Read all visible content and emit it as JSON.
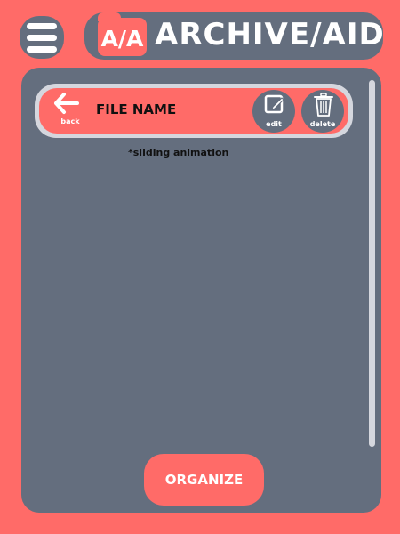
{
  "app": {
    "logo_text": "A/A",
    "title": "ARCHIVE/AID"
  },
  "file_bar": {
    "back_label": "back",
    "file_name": "FILE NAME",
    "edit_label": "edit",
    "delete_label": "delete"
  },
  "note": "*sliding animation",
  "actions": {
    "organize_label": "ORGANIZE"
  },
  "colors": {
    "background": "#ff6b68",
    "panel": "#646e7e",
    "light": "#d5d7de",
    "accent": "#ff6b68"
  },
  "icons": [
    "menu-icon",
    "folder-logo",
    "back-arrow-icon",
    "edit-icon",
    "trash-icon"
  ]
}
